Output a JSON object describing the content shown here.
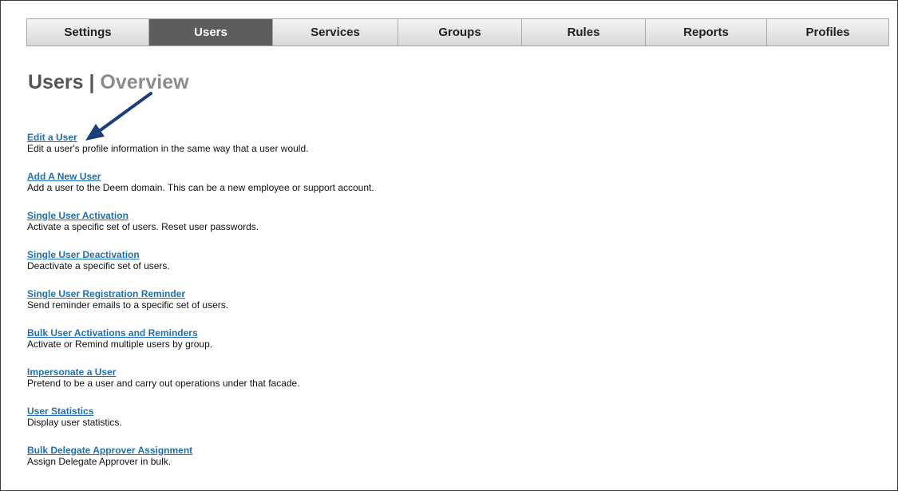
{
  "nav": {
    "tabs": [
      {
        "label": "Settings",
        "active": false
      },
      {
        "label": "Users",
        "active": true
      },
      {
        "label": "Services",
        "active": false
      },
      {
        "label": "Groups",
        "active": false
      },
      {
        "label": "Rules",
        "active": false
      },
      {
        "label": "Reports",
        "active": false
      },
      {
        "label": "Profiles",
        "active": false
      }
    ]
  },
  "header": {
    "section": "Users",
    "separator": "|",
    "subsection": "Overview"
  },
  "colors": {
    "link": "#1f6fb5",
    "active_tab_bg": "#5d5d5d",
    "arrow": "#1c3f7a"
  },
  "annotation": {
    "icon": "arrow-pointer-icon",
    "points_to": "Edit a User"
  },
  "items": [
    {
      "title": "Edit a User",
      "description": "Edit a user's profile information in the same way that a user would."
    },
    {
      "title": "Add A New User",
      "description": "Add a user to the Deem domain. This can be a new employee or support account."
    },
    {
      "title": "Single User Activation",
      "description": "Activate a specific set of users. Reset user passwords."
    },
    {
      "title": "Single User Deactivation",
      "description": "Deactivate a specific set of users."
    },
    {
      "title": "Single User Registration Reminder",
      "description": "Send reminder emails to a specific set of users."
    },
    {
      "title": "Bulk User Activations and Reminders",
      "description": "Activate or Remind multiple users by group."
    },
    {
      "title": "Impersonate a User",
      "description": "Pretend to be a user and carry out operations under that facade."
    },
    {
      "title": "User Statistics",
      "description": "Display user statistics."
    },
    {
      "title": "Bulk Delegate Approver Assignment",
      "description": "Assign Delegate Approver in bulk."
    }
  ]
}
